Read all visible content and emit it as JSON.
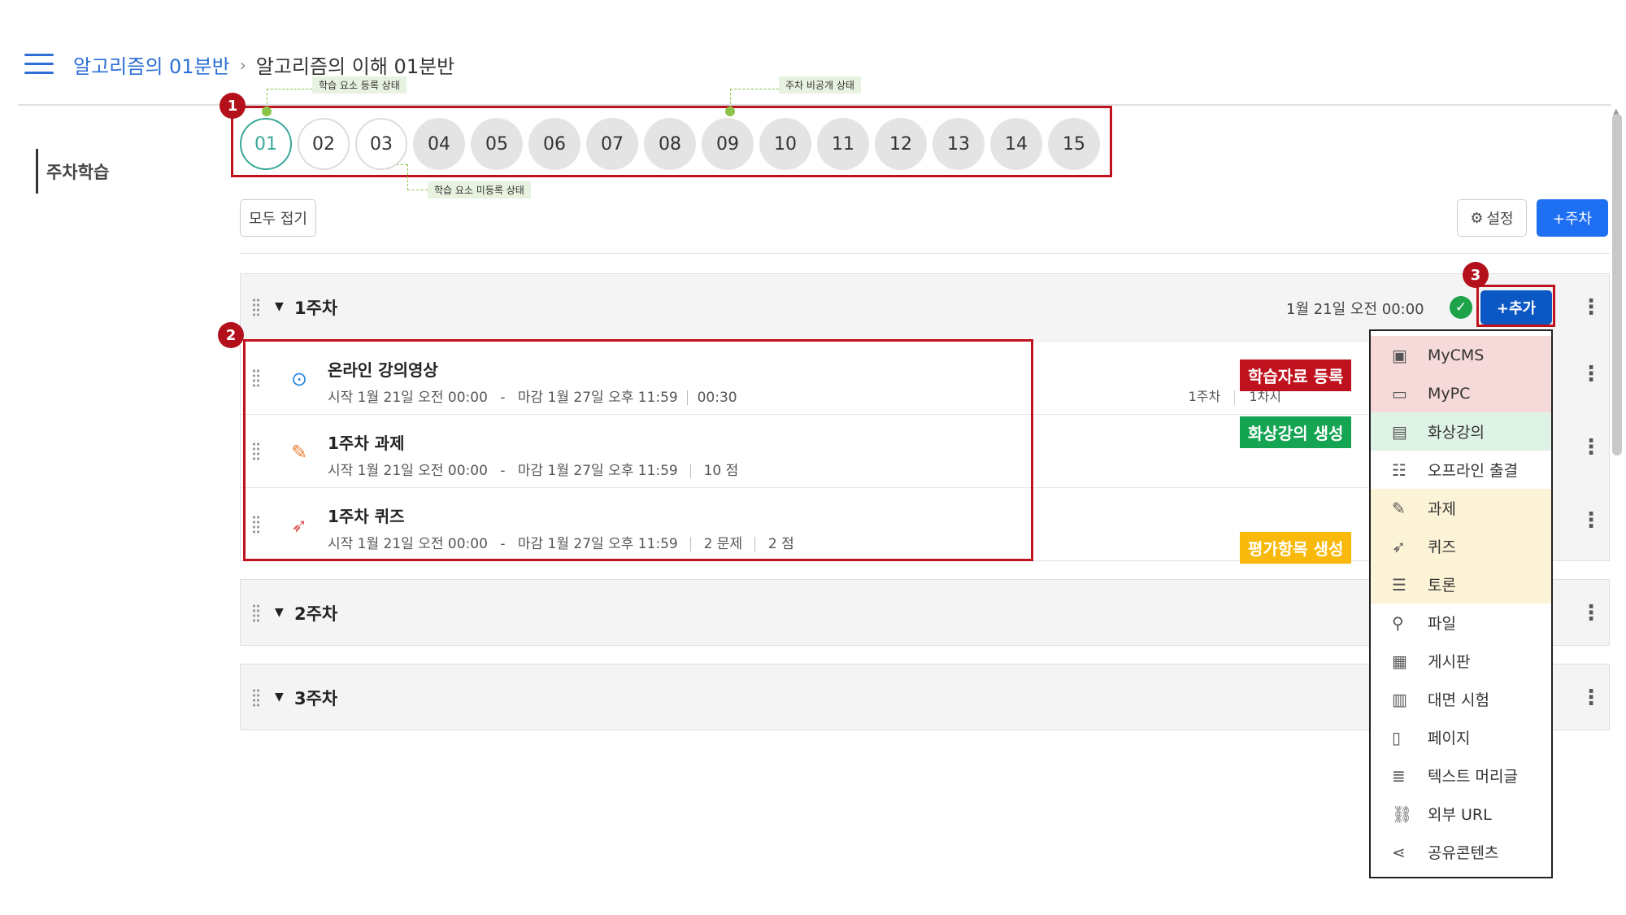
{
  "header": {
    "menu_icon": "hamburger-menu-icon",
    "breadcrumb_course": "알고리즘의 01분반",
    "breadcrumb_sep": "›",
    "breadcrumb_current": "알고리즘의 이해 01분반"
  },
  "sidebar": {
    "active_item": "주차학습"
  },
  "annotations": {
    "num1": "1",
    "num2": "2",
    "num3": "3",
    "note_registered": "학습 요소 등록 상태",
    "note_private": "주차 비공개 상태",
    "note_unregistered": "학습 요소 미등록 상태"
  },
  "weeks_nav": [
    "01",
    "02",
    "03",
    "04",
    "05",
    "06",
    "07",
    "08",
    "09",
    "10",
    "11",
    "12",
    "13",
    "14",
    "15"
  ],
  "toolbar": {
    "collapse_all": "모두 접기",
    "settings": "설정",
    "add_week": "+주차"
  },
  "week1": {
    "title": "1주차",
    "date": "1월 21일 오전 00:00",
    "check_icon": "check-circle-icon",
    "add_button": "+추가",
    "items": [
      {
        "icon": "play-circle-icon",
        "title": "온라인 강의영상",
        "start": "시작  1월 21일 오전 00:00",
        "end": "마감  1월 27일 오후 11:59",
        "extra": "00:30",
        "tag1": "1주차",
        "tag2": "1차시"
      },
      {
        "icon": "assignment-edit-icon",
        "title": "1주차 과제",
        "start": "시작  1월 21일 오전 00:00",
        "end": "마감  1월 27일 오후 11:59",
        "extra": "10 점"
      },
      {
        "icon": "rocket-icon",
        "title": "1주차 퀴즈",
        "start": "시작  1월 21일 오전 00:00",
        "end": "마감  1월 27일 오후 11:59",
        "extra": "2 문제",
        "extra2": "2 점"
      }
    ]
  },
  "week2": {
    "title": "2주차"
  },
  "week3": {
    "title": "3주차"
  },
  "labels": {
    "material": "학습자료 등록",
    "video_conf": "화상강의 생성",
    "evaluation": "평가항목 생성"
  },
  "dropdown": [
    {
      "icon": "cms-icon",
      "label": "MyCMS"
    },
    {
      "icon": "monitor-icon",
      "label": "MyPC"
    },
    {
      "icon": "live-icon",
      "label": "화상강의"
    },
    {
      "icon": "offline-attendance-icon",
      "label": "오프라인 출결"
    },
    {
      "icon": "assignment-icon",
      "label": "과제"
    },
    {
      "icon": "rocket-icon",
      "label": "퀴즈"
    },
    {
      "icon": "discussion-icon",
      "label": "토론"
    },
    {
      "icon": "paperclip-icon",
      "label": "파일"
    },
    {
      "icon": "board-icon",
      "label": "게시판"
    },
    {
      "icon": "exam-icon",
      "label": "대면 시험"
    },
    {
      "icon": "page-icon",
      "label": "페이지"
    },
    {
      "icon": "list-icon",
      "label": "텍스트 머리글"
    },
    {
      "icon": "link-icon",
      "label": "외부 URL"
    },
    {
      "icon": "share-icon",
      "label": "공유콘텐츠"
    }
  ],
  "colors": {
    "accent": "#1e6ff1",
    "annotation_red": "#c0121e",
    "active_week": "#3aa89a",
    "status_green": "#1fa34a"
  }
}
